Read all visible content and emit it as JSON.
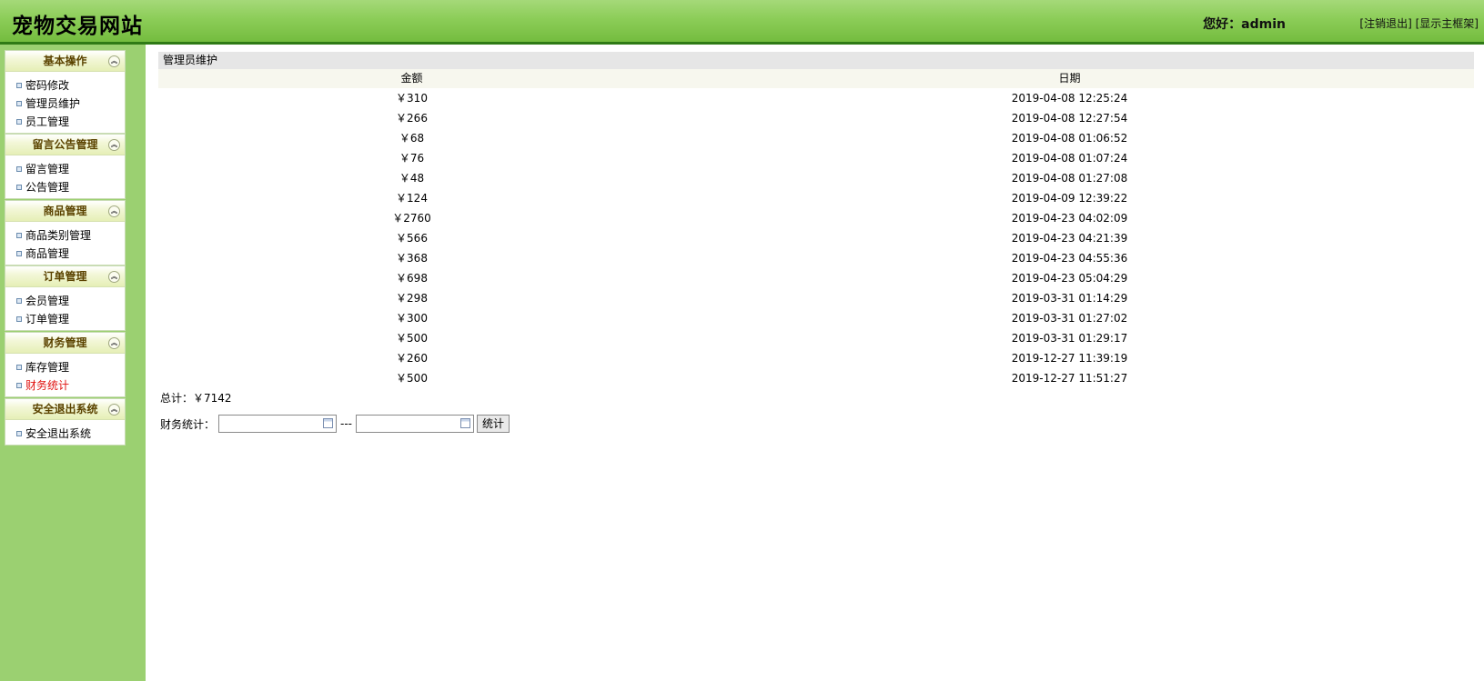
{
  "header": {
    "site_title": "宠物交易网站",
    "greeting": "您好：admin",
    "logout_link": "[注销退出]",
    "show_frame_link": "[显示主框架]"
  },
  "sidebar": {
    "groups": [
      {
        "title": "基本操作",
        "items": [
          "密码修改",
          "管理员维护",
          "员工管理"
        ]
      },
      {
        "title": "留言公告管理",
        "items": [
          "留言管理",
          "公告管理"
        ]
      },
      {
        "title": "商品管理",
        "items": [
          "商品类别管理",
          "商品管理"
        ]
      },
      {
        "title": "订单管理",
        "items": [
          "会员管理",
          "订单管理"
        ]
      },
      {
        "title": "财务管理",
        "items": [
          "库存管理",
          "财务统计"
        ]
      },
      {
        "title": "安全退出系统",
        "items": [
          "安全退出系统"
        ]
      }
    ],
    "active_item": "财务统计"
  },
  "main": {
    "panel_title": "管理员维护",
    "columns": [
      "金额",
      "日期"
    ],
    "rows": [
      {
        "amount": "￥310",
        "date": "2019-04-08 12:25:24"
      },
      {
        "amount": "￥266",
        "date": "2019-04-08 12:27:54"
      },
      {
        "amount": "￥68",
        "date": "2019-04-08 01:06:52"
      },
      {
        "amount": "￥76",
        "date": "2019-04-08 01:07:24"
      },
      {
        "amount": "￥48",
        "date": "2019-04-08 01:27:08"
      },
      {
        "amount": "￥124",
        "date": "2019-04-09 12:39:22"
      },
      {
        "amount": "￥2760",
        "date": "2019-04-23 04:02:09"
      },
      {
        "amount": "￥566",
        "date": "2019-04-23 04:21:39"
      },
      {
        "amount": "￥368",
        "date": "2019-04-23 04:55:36"
      },
      {
        "amount": "￥698",
        "date": "2019-04-23 05:04:29"
      },
      {
        "amount": "￥298",
        "date": "2019-03-31 01:14:29"
      },
      {
        "amount": "￥300",
        "date": "2019-03-31 01:27:02"
      },
      {
        "amount": "￥500",
        "date": "2019-03-31 01:29:17"
      },
      {
        "amount": "￥260",
        "date": "2019-12-27 11:39:19"
      },
      {
        "amount": "￥500",
        "date": "2019-12-27 11:51:27"
      }
    ],
    "total_label": "总计：￥7142",
    "stats_label": "财务统计：",
    "start_date_value": "",
    "separator": "---",
    "end_date_value": "",
    "stats_button": "统计"
  },
  "colors": {
    "header_green": "#8ccd58",
    "sidebar_green": "#9bd071",
    "active_red": "#e0120f"
  }
}
